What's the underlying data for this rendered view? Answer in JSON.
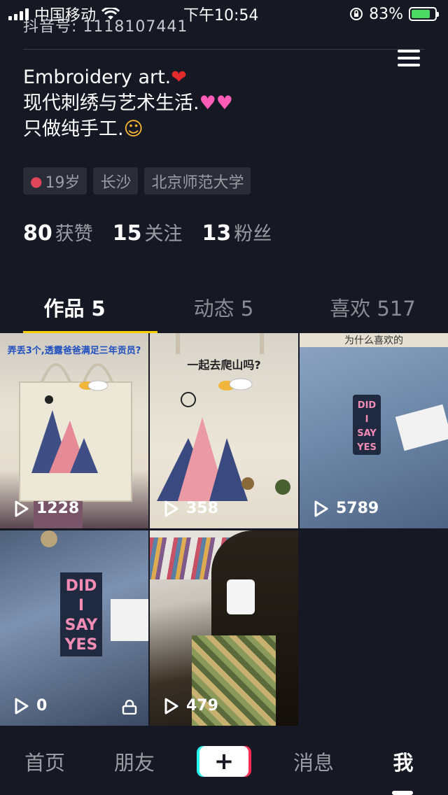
{
  "status_bar": {
    "carrier": "中国移动",
    "time": "下午10:54",
    "battery": "83%"
  },
  "profile": {
    "douyin_id": "抖音号: 1118107441",
    "bio_lines": [
      "Embroidery art.",
      "现代刺绣与艺术生活.",
      "只做纯手工."
    ],
    "tags": [
      "19岁",
      "长沙",
      "北京师范大学"
    ],
    "stats": [
      {
        "num": "80",
        "label": "获赞"
      },
      {
        "num": "15",
        "label": "关注"
      },
      {
        "num": "13",
        "label": "粉丝"
      }
    ]
  },
  "tabs": [
    {
      "label": "作品 5",
      "active": true
    },
    {
      "label": "动态 5",
      "active": false
    },
    {
      "label": "喜欢 517",
      "active": false
    }
  ],
  "videos": [
    {
      "plays": "1228",
      "locked": false
    },
    {
      "plays": "358",
      "locked": false
    },
    {
      "plays": "5789",
      "locked": false
    },
    {
      "plays": "0",
      "locked": true
    },
    {
      "plays": "479",
      "locked": false
    }
  ],
  "thumbnail_text": {
    "v1": "弄丢3个,透露爸爸满足三年贡员?",
    "v2": "一起去爬山吗?",
    "v3": "为什么喜欢的",
    "label_did": "DID",
    "label_i": "I",
    "label_say": "SAY",
    "label_yes": "YES"
  },
  "nav": {
    "home": "首页",
    "friends": "朋友",
    "plus": "+",
    "messages": "消息",
    "me": "我"
  },
  "colors": {
    "background": "#161823",
    "tab_indicator": "#facd00",
    "muted_text": "#9b9ca4"
  }
}
